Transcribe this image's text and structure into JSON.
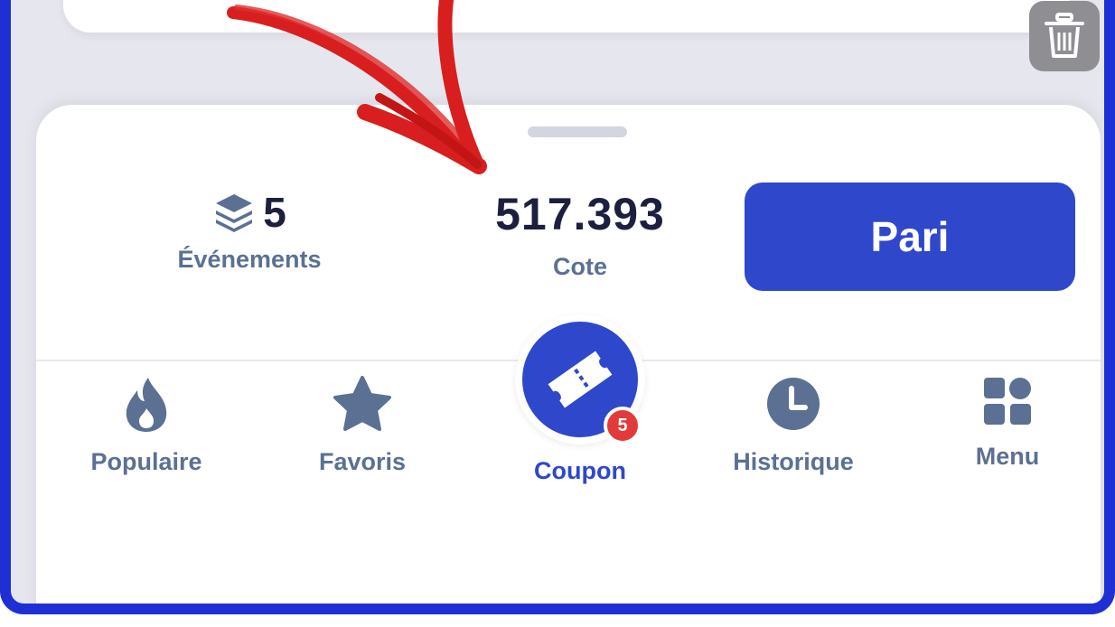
{
  "summary": {
    "events_count": "5",
    "events_label": "Événements",
    "odds_value": "517.393",
    "odds_label": "Cote",
    "bet_button_label": "Pari"
  },
  "nav": {
    "popular": {
      "label": "Populaire",
      "icon": "flame-icon"
    },
    "favorites": {
      "label": "Favoris",
      "icon": "star-icon"
    },
    "coupon": {
      "label": "Coupon",
      "icon": "ticket-icon",
      "badge_count": "5"
    },
    "history": {
      "label": "Historique",
      "icon": "clock-icon"
    },
    "menu": {
      "label": "Menu",
      "icon": "grid-icon"
    }
  },
  "overlay": {
    "trash_icon": "trash-icon",
    "annotation": "red-arrow"
  },
  "colors": {
    "accent": "#2f47cb",
    "frame_border": "#1f2fd6",
    "badge": "#e23a3a",
    "icon": "#5b7093",
    "arrow": "#d81e1e"
  }
}
